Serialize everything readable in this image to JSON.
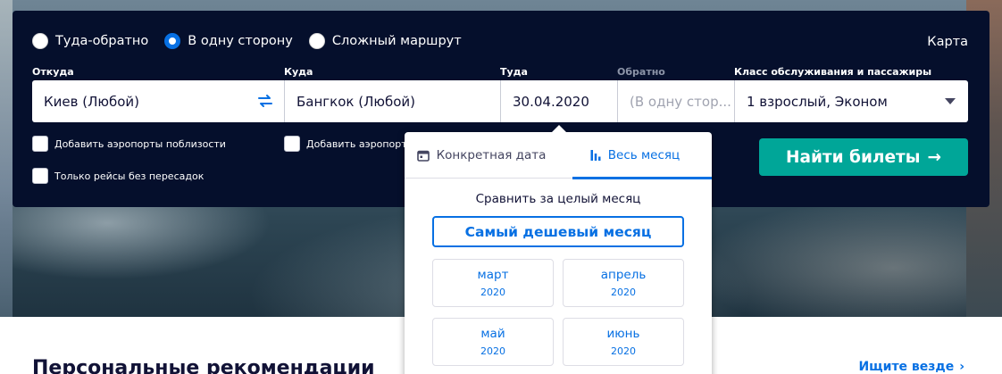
{
  "trip_types": [
    {
      "label": "Туда-обратно",
      "selected": false
    },
    {
      "label": "В одну сторону",
      "selected": true
    },
    {
      "label": "Сложный маршрут",
      "selected": false
    }
  ],
  "map_link": "Карта",
  "labels": {
    "from": "Откуда",
    "to": "Куда",
    "depart": "Туда",
    "return": "Обратно",
    "class": "Класс обслуживания и пассажиры"
  },
  "fields": {
    "from_value": "Киев (Любой)",
    "to_value": "Бангкок (Любой)",
    "depart_value": "30.04.2020",
    "return_placeholder": "(В одну стор...",
    "class_value": "1 взрослый, Эконом"
  },
  "checkboxes": {
    "nearby_from": "Добавить аэропорты поблизости",
    "nearby_to": "Добавить аэропорт",
    "direct_only": "Только рейсы без пересадок"
  },
  "search_button": "Найти билеты",
  "search_button_arrow": "→",
  "popup": {
    "tab_specific": "Конкретная дата",
    "tab_month": "Весь месяц",
    "compare_text": "Сравнить за целый месяц",
    "cheapest_button": "Самый дешевый месяц",
    "months": [
      {
        "name": "март",
        "year": "2020"
      },
      {
        "name": "апрель",
        "year": "2020"
      },
      {
        "name": "май",
        "year": "2020"
      },
      {
        "name": "июнь",
        "year": "2020"
      }
    ]
  },
  "bottom": {
    "title": "Персональные рекомендации",
    "explore_link": "Ищите везде",
    "explore_chevron": "›"
  },
  "colors": {
    "panel_bg": "#050f2c",
    "accent_blue": "#0770e3",
    "cta_green": "#00a698"
  }
}
